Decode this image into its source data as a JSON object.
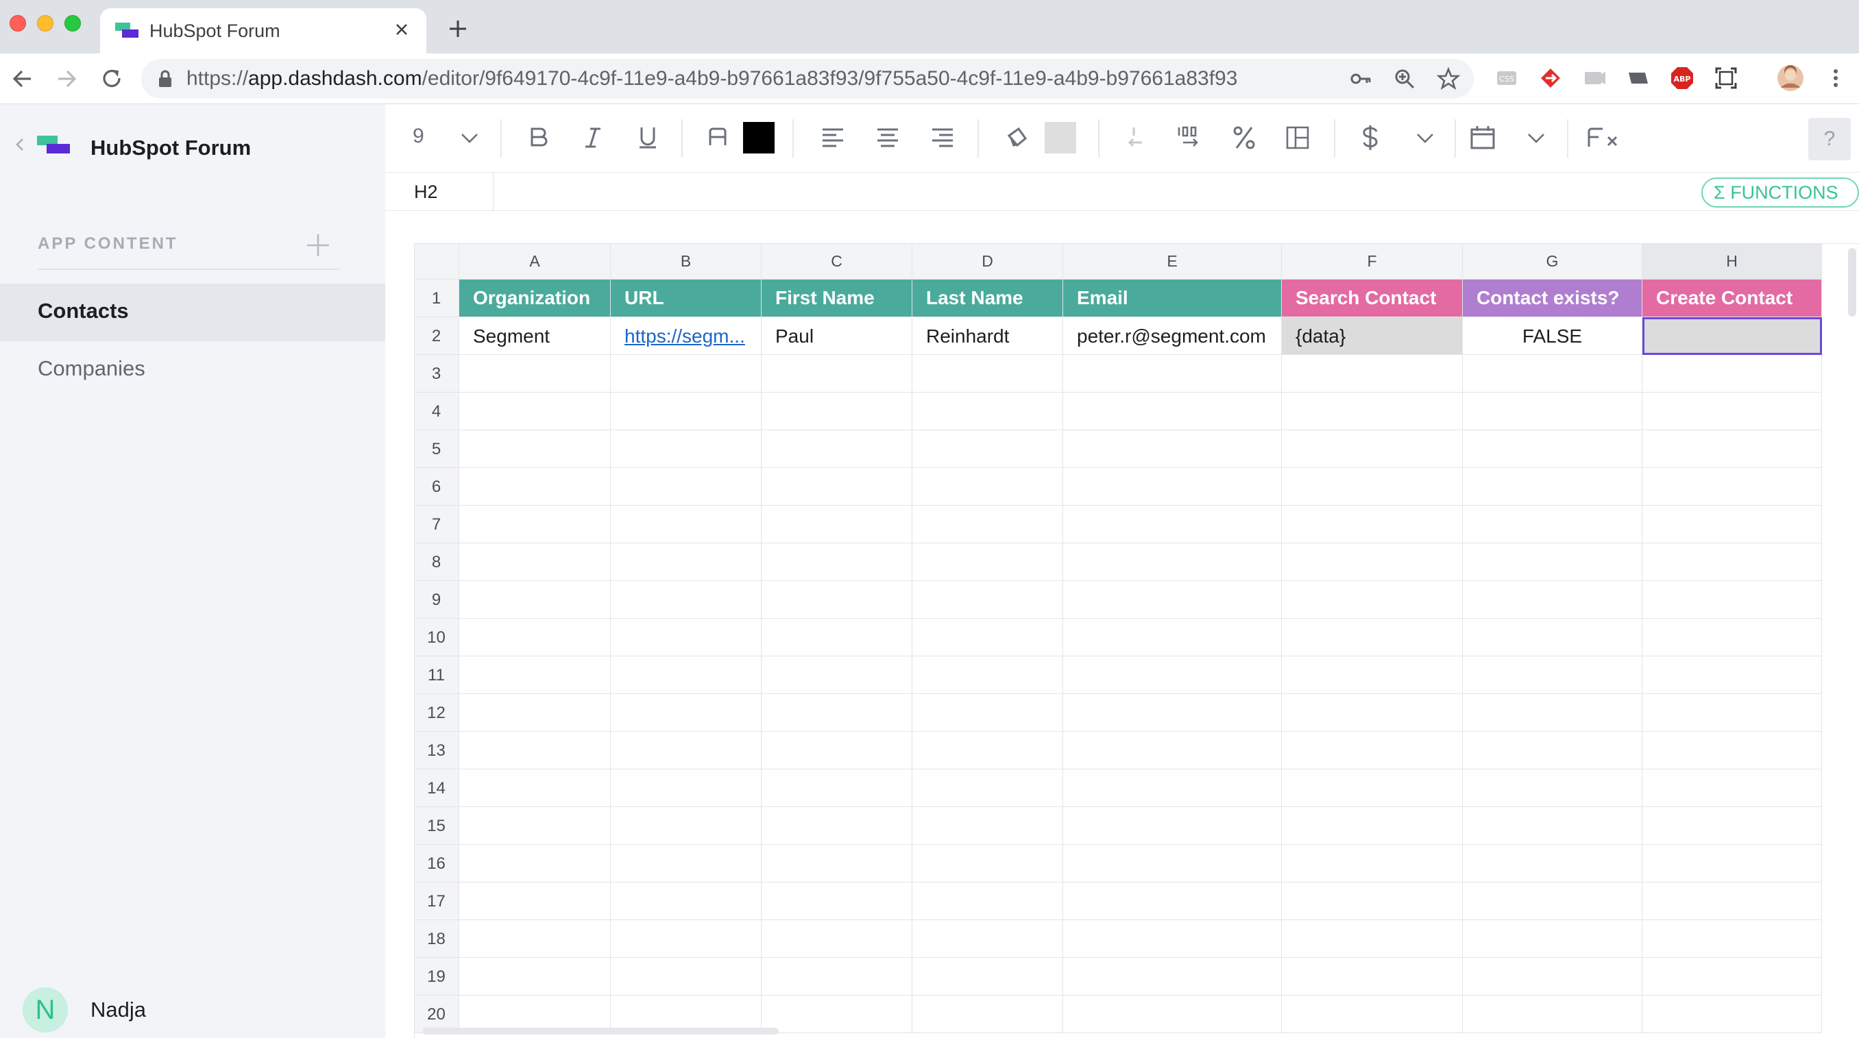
{
  "browser": {
    "tab_title": "HubSpot Forum",
    "url_scheme": "https://",
    "url_host": "app.dashdash.com",
    "url_path": "/editor/9f649170-4c9f-11e9-a4b9-b97661a83f93/9f755a50-4c9f-11e9-a4b9-b97661a83f93"
  },
  "sidebar": {
    "app_name": "HubSpot Forum",
    "section_label": "APP CONTENT",
    "items": [
      {
        "label": "Contacts",
        "active": true
      },
      {
        "label": "Companies",
        "active": false
      }
    ],
    "user": {
      "initial": "N",
      "name": "Nadja"
    }
  },
  "toolbar": {
    "font_size": "9",
    "text_color": "#000000",
    "fill_color": "#dedede",
    "help_label": "?"
  },
  "formula_bar": {
    "cell_ref": "H2",
    "functions_label": "Σ FUNCTIONS"
  },
  "sheet": {
    "selected_cell": "H2",
    "columns": [
      "A",
      "B",
      "C",
      "D",
      "E",
      "F",
      "G",
      "H"
    ],
    "header_row": [
      {
        "text": "Organization",
        "color": "#4aab9c"
      },
      {
        "text": "URL",
        "color": "#4aab9c"
      },
      {
        "text": "First Name",
        "color": "#4aab9c"
      },
      {
        "text": "Last Name",
        "color": "#4aab9c"
      },
      {
        "text": "Email",
        "color": "#4aab9c"
      },
      {
        "text": "Search Contact",
        "color": "#e36aa3"
      },
      {
        "text": "Contact exists?",
        "color": "#b07ed0"
      },
      {
        "text": "Create Contact",
        "color": "#e36aa3"
      }
    ],
    "rows": [
      [
        "Segment",
        "https://segm...",
        "Paul",
        "Reinhardt",
        "peter.r@segment.com",
        "{data}",
        "FALSE",
        ""
      ]
    ],
    "row_numbers": [
      "1",
      "2",
      "3",
      "4",
      "5",
      "6",
      "7",
      "8",
      "9",
      "10",
      "11",
      "12",
      "13",
      "14",
      "15",
      "16",
      "17",
      "18",
      "19",
      "20"
    ]
  }
}
